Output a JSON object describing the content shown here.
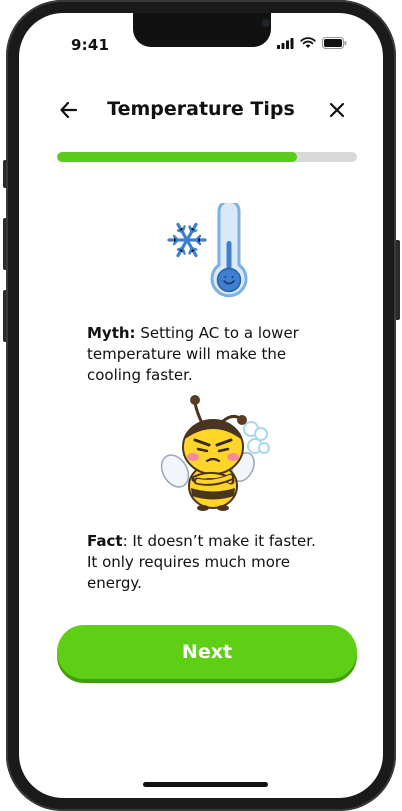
{
  "status": {
    "time": "9:41"
  },
  "header": {
    "title": "Temperature Tips"
  },
  "progress": {
    "fraction": 0.8
  },
  "myth": {
    "label": "Myth:",
    "text": " Setting AC to a lower temperature will make the cooling faster."
  },
  "fact": {
    "label": "Fact",
    "text": ": It doesn’t make it faster. It only requires much more energy."
  },
  "actions": {
    "next_label": "Next"
  },
  "colors": {
    "accent": "#5ecf14",
    "progress_track": "#d9d9d9"
  }
}
